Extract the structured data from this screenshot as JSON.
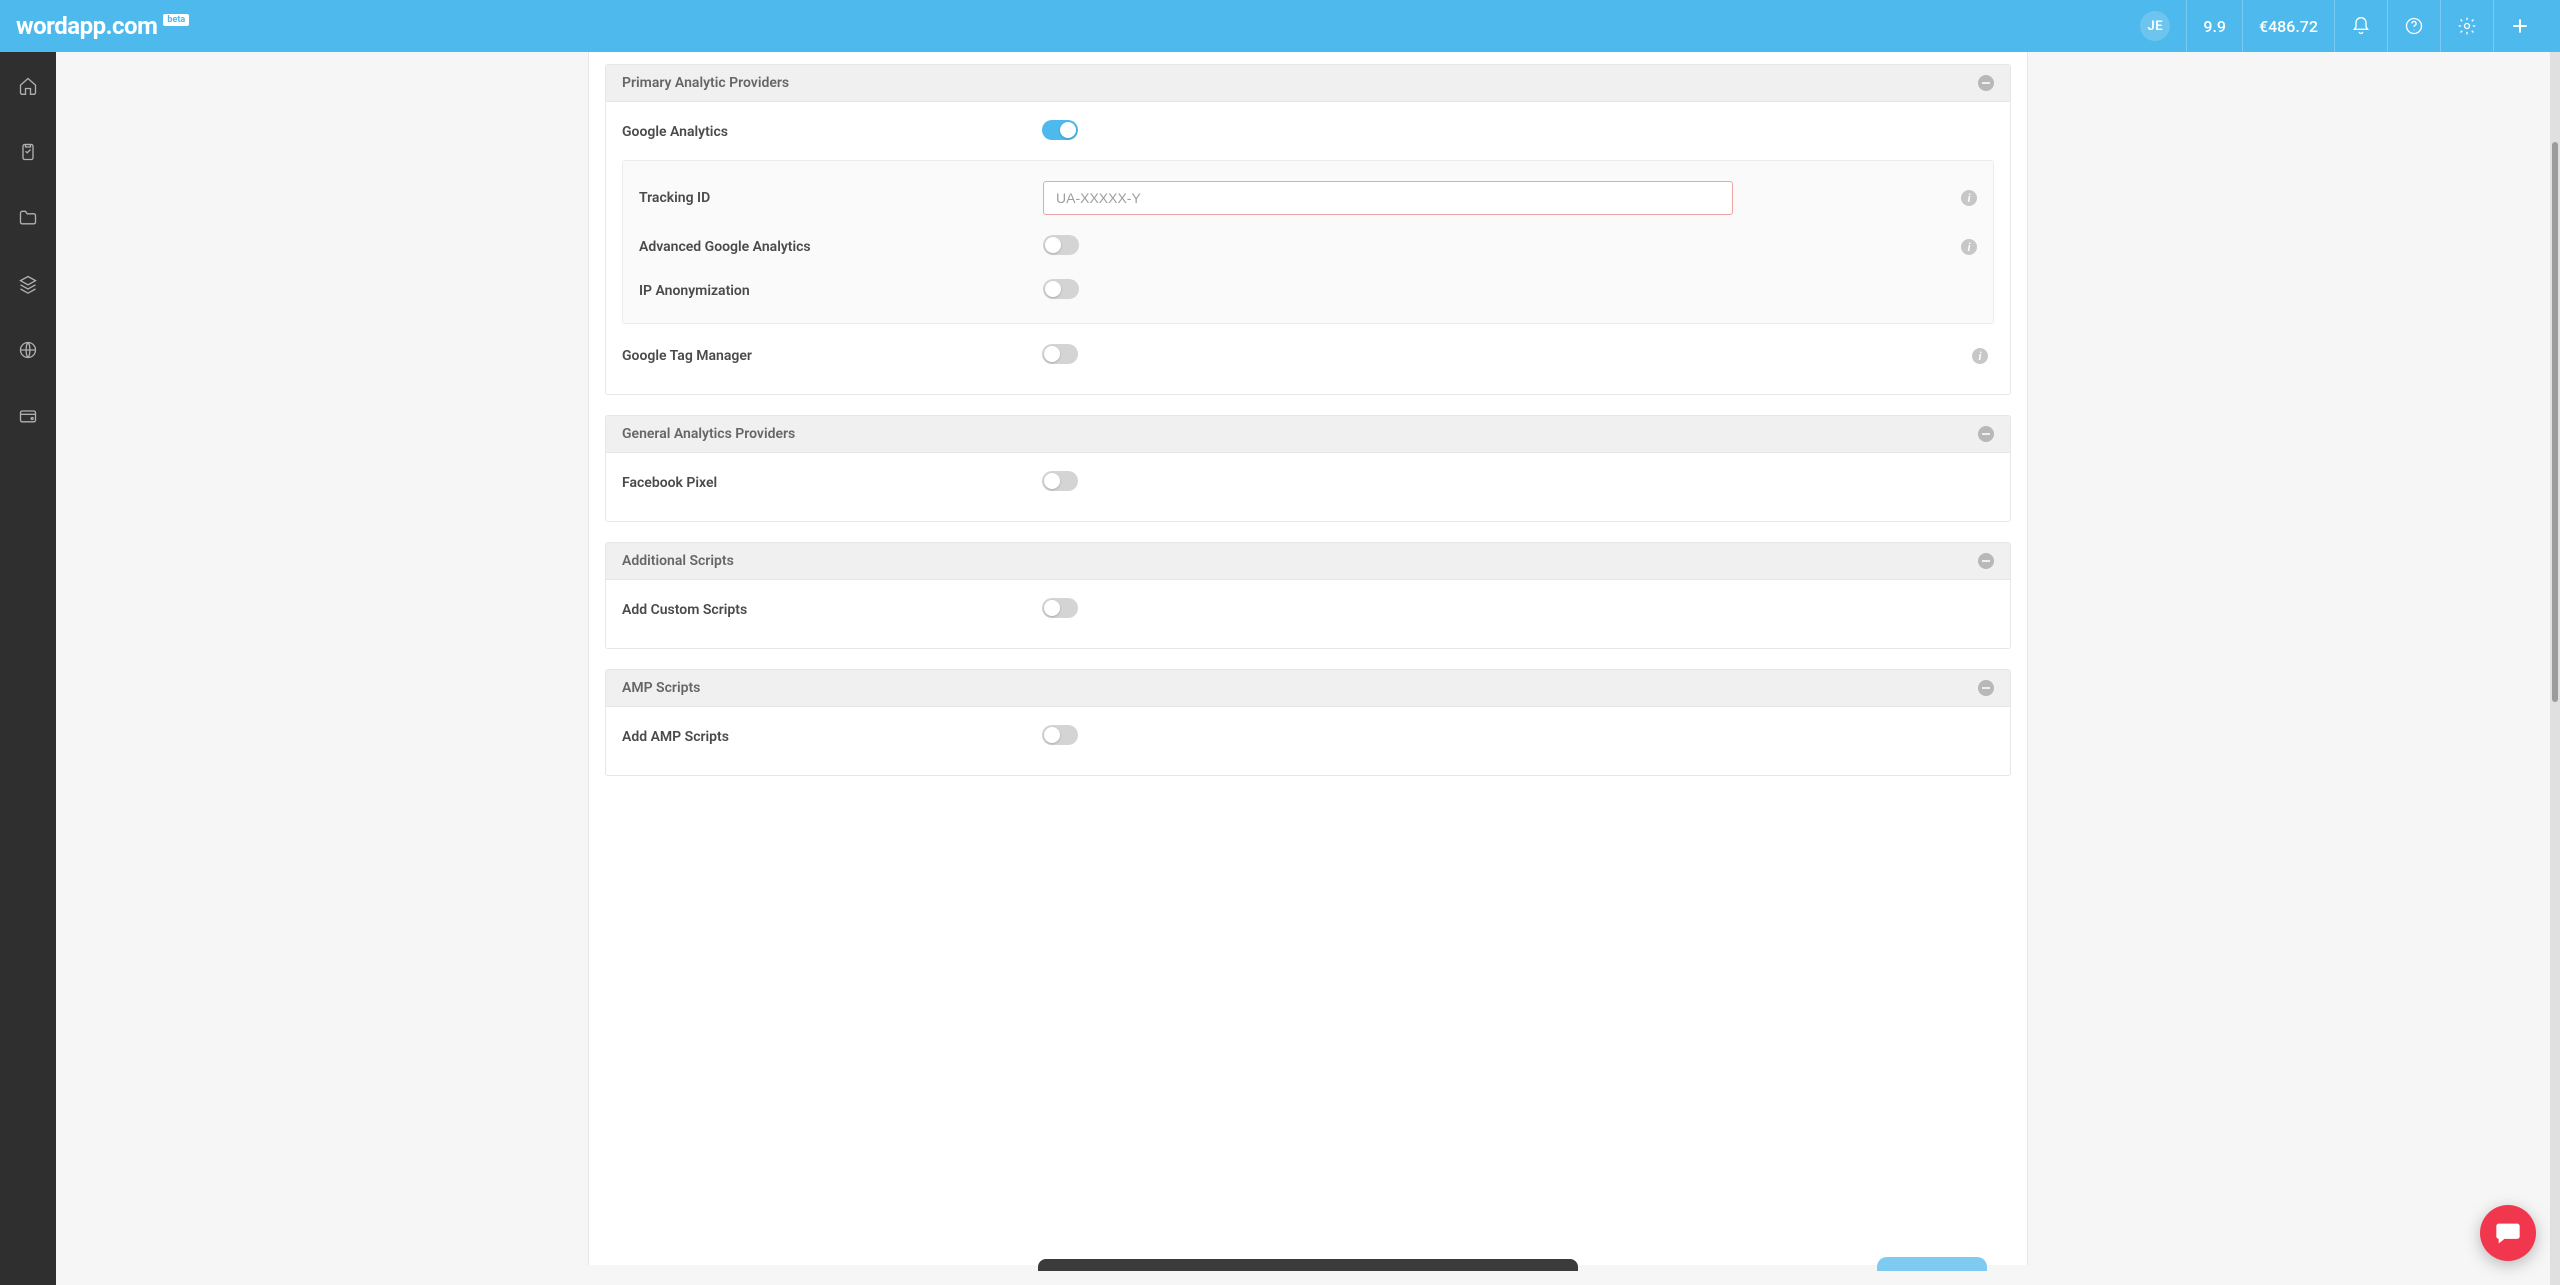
{
  "header": {
    "logo": "wordapp.com",
    "beta": "beta",
    "user_initials": "JE",
    "score": "9.9",
    "balance": "€486.72"
  },
  "sections": {
    "primary": {
      "title": "Primary Analytic Providers",
      "google_analytics_label": "Google Analytics",
      "google_analytics_on": true,
      "tracking_id_label": "Tracking ID",
      "tracking_id_placeholder": "UA-XXXXX-Y",
      "tracking_id_value": "",
      "advanced_ga_label": "Advanced Google Analytics",
      "advanced_ga_on": false,
      "ip_anon_label": "IP Anonymization",
      "ip_anon_on": false,
      "gtm_label": "Google Tag Manager",
      "gtm_on": false
    },
    "general": {
      "title": "General Analytics Providers",
      "fb_pixel_label": "Facebook Pixel",
      "fb_pixel_on": false
    },
    "additional": {
      "title": "Additional Scripts",
      "custom_scripts_label": "Add Custom Scripts",
      "custom_scripts_on": false
    },
    "amp": {
      "title": "AMP Scripts",
      "amp_scripts_label": "Add AMP Scripts",
      "amp_scripts_on": false
    }
  }
}
